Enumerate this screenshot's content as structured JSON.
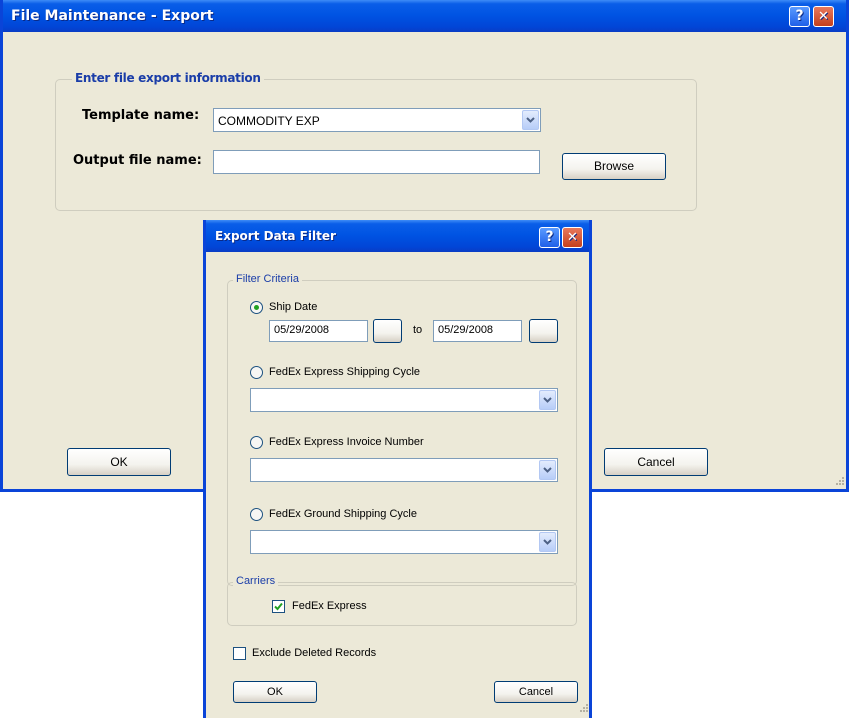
{
  "main_window": {
    "title": "File Maintenance - Export",
    "help_label": "?",
    "close_label": "✕",
    "group_title": "Enter file export information",
    "template_label": "Template name:",
    "template_value": "COMMODITY EXP",
    "output_label": "Output file name:",
    "output_value": "",
    "browse_label": "Browse",
    "ok_label": "OK",
    "cancel_label": "Cancel"
  },
  "filter_dialog": {
    "title": "Export Data Filter",
    "help_label": "?",
    "close_label": "✕",
    "criteria_title": "Filter Criteria",
    "ship_date_label": "Ship Date",
    "date_from": "05/29/2008",
    "date_to": "05/29/2008",
    "to_label": "to",
    "express_cycle_label": "FedEx Express Shipping Cycle",
    "express_cycle_value": "",
    "invoice_label": "FedEx Express Invoice Number",
    "invoice_value": "",
    "ground_cycle_label": "FedEx Ground Shipping Cycle",
    "ground_cycle_value": "",
    "carriers_title": "Carriers",
    "fedex_express_label": "FedEx Express",
    "exclude_deleted_label": "Exclude Deleted Records",
    "ok_label": "OK",
    "cancel_label": "Cancel"
  },
  "colors": {
    "title_bar": "#0054e3",
    "window_bg": "#ece9d8",
    "group_title": "#1a3da8",
    "radio_selected": "#21a121",
    "checkmark": "#21a121"
  }
}
